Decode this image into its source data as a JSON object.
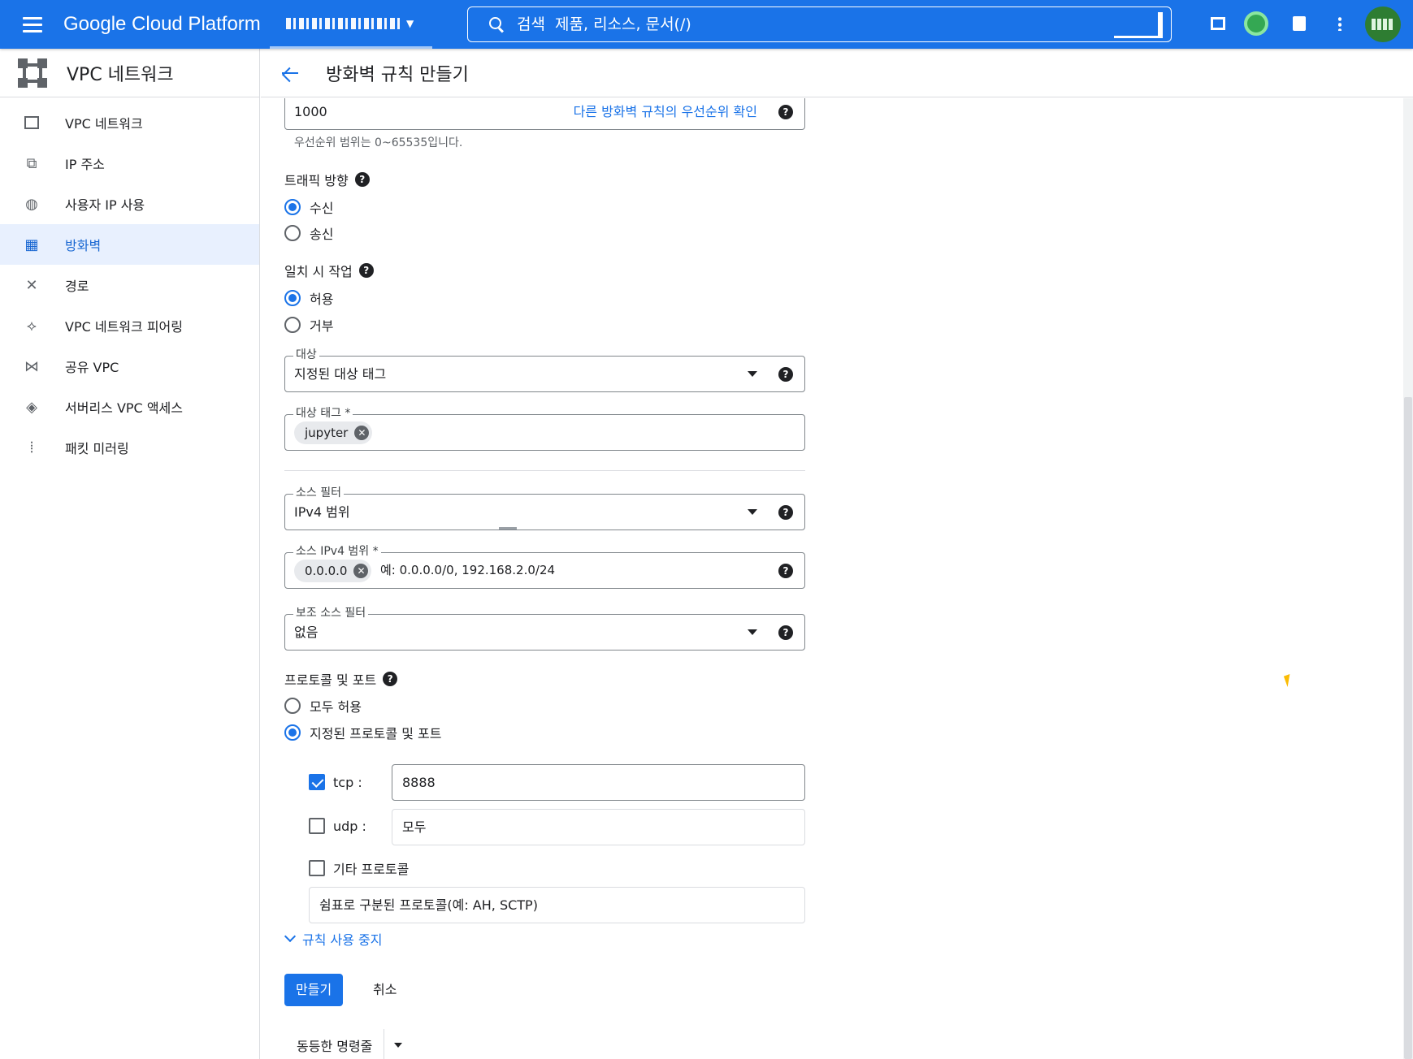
{
  "topbar": {
    "brand": "Google Cloud Platform",
    "search_placeholder": "검색  제품, 리소스, 문서(/)",
    "accent": "#1a73e8"
  },
  "sidebar": {
    "title": "VPC 네트워크",
    "items": [
      {
        "label": "VPC 네트워크",
        "icon": "vpc-network-icon"
      },
      {
        "label": "IP 주소",
        "icon": "ip-address-icon"
      },
      {
        "label": "사용자 IP 사용",
        "icon": "globe-icon"
      },
      {
        "label": "방화벽",
        "icon": "firewall-icon",
        "active": true
      },
      {
        "label": "경로",
        "icon": "routes-icon"
      },
      {
        "label": "VPC 네트워크 피어링",
        "icon": "peering-icon"
      },
      {
        "label": "공유 VPC",
        "icon": "shared-vpc-icon"
      },
      {
        "label": "서버리스 VPC 액세스",
        "icon": "serverless-icon"
      },
      {
        "label": "패킷 미러링",
        "icon": "packet-mirroring-icon"
      }
    ]
  },
  "main": {
    "title": "방화벽 규칙 만들기"
  },
  "form": {
    "priority": {
      "value": "1000",
      "link": "다른 방화벽 규칙의 우선순위 확인",
      "hint": "우선순위 범위는 0~65535입니다."
    },
    "direction": {
      "title": "트래픽 방향",
      "options": [
        "수신",
        "송신"
      ],
      "selected": "수신"
    },
    "action": {
      "title": "일치 시 작업",
      "options": [
        "허용",
        "거부"
      ],
      "selected": "허용"
    },
    "targets": {
      "label": "대상",
      "value": "지정된 대상 태그"
    },
    "target_tags": {
      "label": "대상 태그 *",
      "chips": [
        "jupyter"
      ]
    },
    "source_filter": {
      "label": "소스 필터",
      "value": "IPv4 범위"
    },
    "source_ranges": {
      "label": "소스 IPv4 범위 *",
      "chips": [
        "0.0.0.0"
      ],
      "placeholder": "예: 0.0.0.0/0, 192.168.2.0/24"
    },
    "second_source_filter": {
      "label": "보조 소스 필터",
      "value": "없음"
    },
    "protocols": {
      "title": "프로토콜 및 포트",
      "options": [
        "모두 허용",
        "지정된 프로토콜 및 포트"
      ],
      "selected": "지정된 프로토콜 및 포트",
      "tcp": {
        "label": "tcp :",
        "checked": true,
        "value": "8888"
      },
      "udp": {
        "label": "udp :",
        "checked": false,
        "placeholder": "모두"
      },
      "other": {
        "label": "기타 프로토콜",
        "checked": false,
        "placeholder": "쉼표로 구분된 프로토콜(예: AH, SCTP)"
      }
    },
    "disable_rule_toggle": "규칙 사용 중지",
    "create_label": "만들기",
    "cancel_label": "취소",
    "command_line_label": "동등한 명령줄"
  }
}
